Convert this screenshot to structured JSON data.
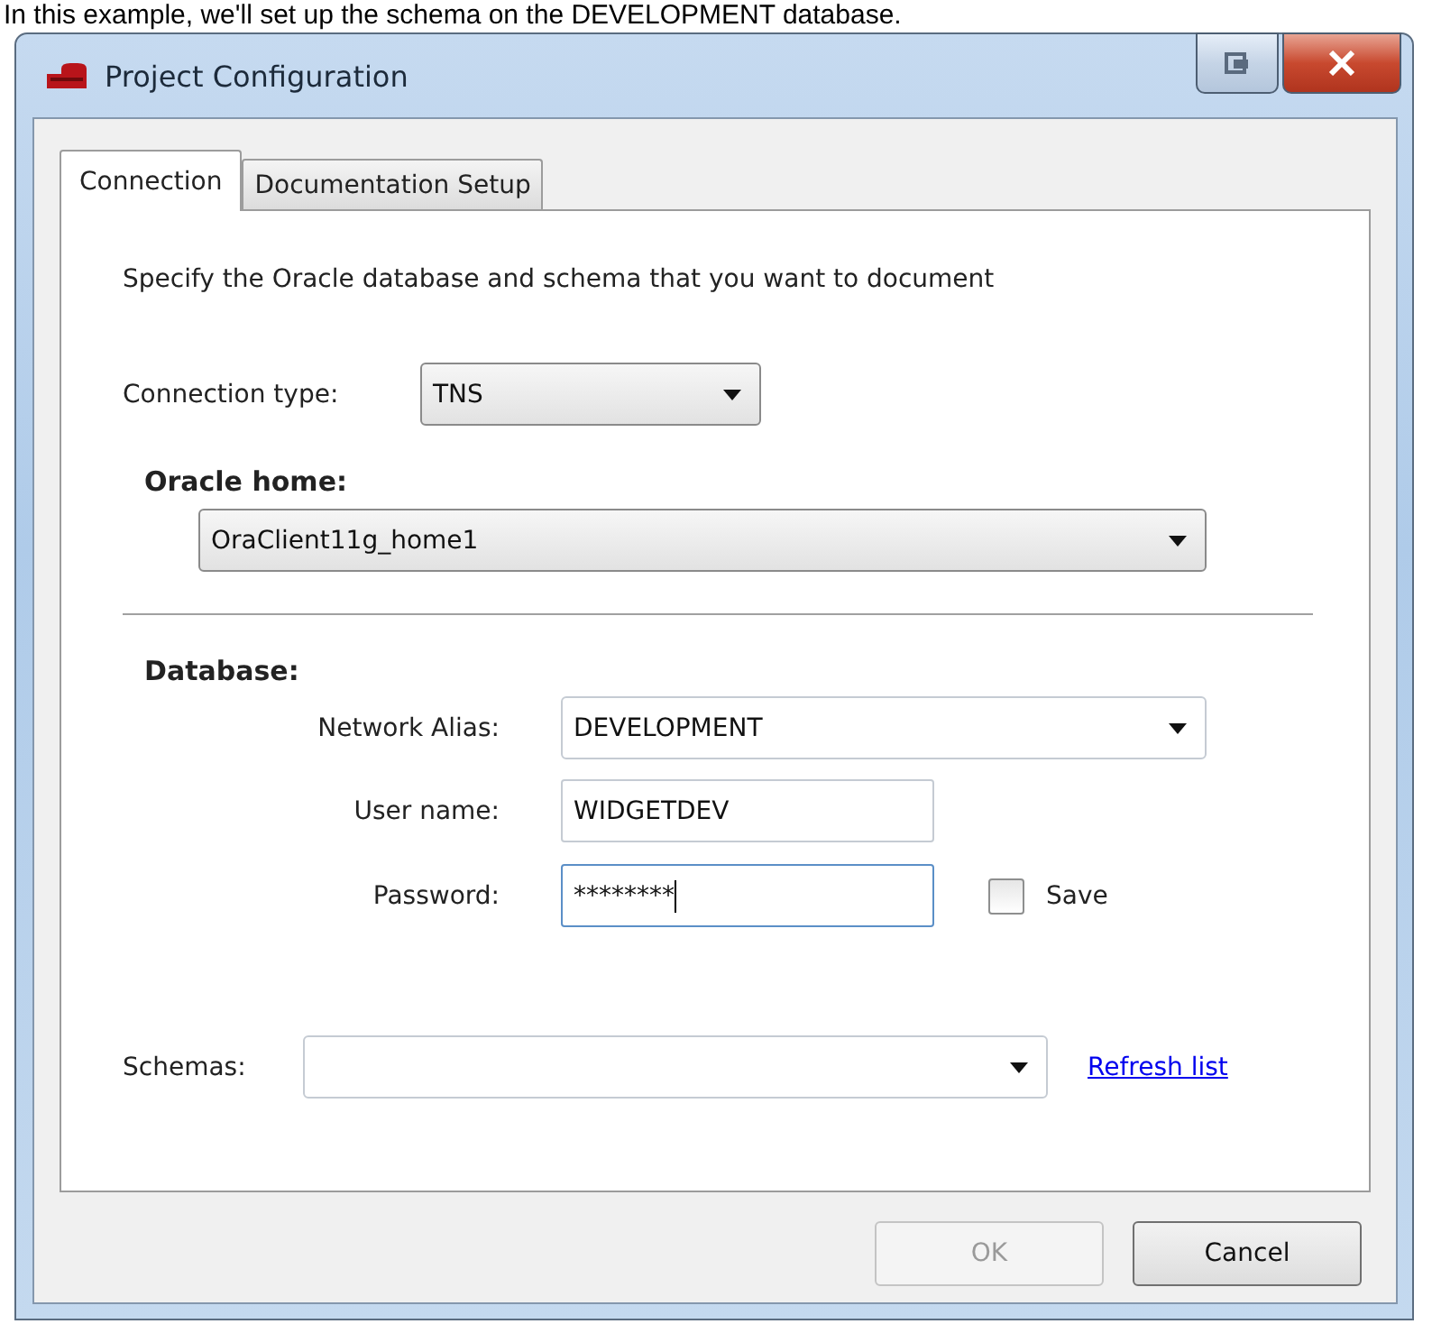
{
  "caption": "In this example, we'll set up the schema on the DEVELOPMENT database.",
  "window": {
    "title": "Project Configuration"
  },
  "tabs": [
    {
      "label": "Connection",
      "selected": true
    },
    {
      "label": "Documentation Setup",
      "selected": false
    }
  ],
  "description": "Specify the Oracle database and schema that you want to document",
  "connection_type": {
    "label": "Connection type:",
    "value": "TNS"
  },
  "oracle_home": {
    "label": "Oracle home:",
    "value": "OraClient11g_home1"
  },
  "database": {
    "heading": "Database:",
    "network_alias": {
      "label": "Network Alias:",
      "value": "DEVELOPMENT"
    },
    "user_name": {
      "label": "User name:",
      "value": "WIDGETDEV"
    },
    "password": {
      "label": "Password:",
      "value": "********",
      "focused": true
    },
    "save": {
      "label": "Save",
      "checked": false
    }
  },
  "schemas": {
    "label": "Schemas:",
    "link": "Refresh list"
  },
  "buttons": [
    {
      "label": "OK",
      "disabled": true
    },
    {
      "label": "Cancel",
      "disabled": false
    }
  ]
}
